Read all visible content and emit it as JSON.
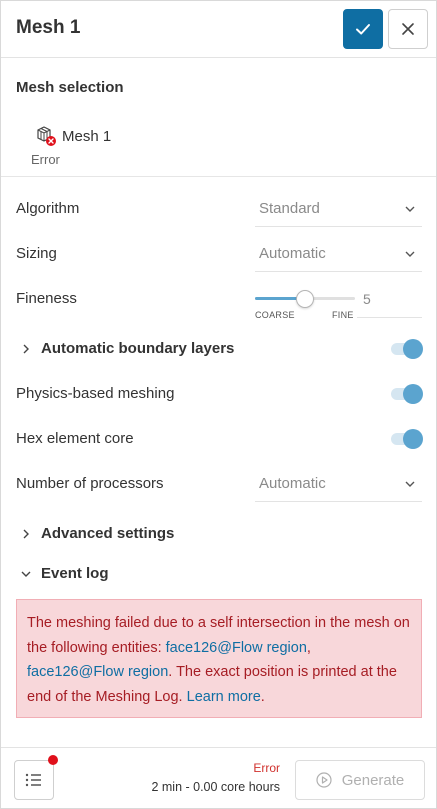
{
  "header": {
    "title": "Mesh 1"
  },
  "mesh_selection": {
    "title": "Mesh selection",
    "item_name": "Mesh 1",
    "item_status": "Error"
  },
  "settings": {
    "algorithm": {
      "label": "Algorithm",
      "value": "Standard"
    },
    "sizing": {
      "label": "Sizing",
      "value": "Automatic"
    },
    "fineness": {
      "label": "Fineness",
      "value": "5",
      "min_label": "COARSE",
      "max_label": "FINE",
      "level_fraction": 0.5
    },
    "auto_boundary_layers": {
      "label": "Automatic boundary layers",
      "enabled": true
    },
    "physics_based_meshing": {
      "label": "Physics-based meshing",
      "enabled": true
    },
    "hex_element_core": {
      "label": "Hex element core",
      "enabled": true
    },
    "processors": {
      "label": "Number of processors",
      "value": "Automatic"
    },
    "advanced": {
      "label": "Advanced settings"
    },
    "event_log": {
      "label": "Event log"
    }
  },
  "error_message": {
    "text_1": "The meshing failed due to a self intersection in the mesh on the following entities: ",
    "entity_1": "face126@Flow region",
    "separator": ", ",
    "entity_2": "face126@Flow region",
    "text_2": ". The exact position is printed at the end of the Meshing Log. ",
    "learn_more": "Learn more",
    "text_3": "."
  },
  "footer": {
    "status": "Error",
    "time": "2 min - 0.00 core hours",
    "generate_label": "Generate"
  },
  "colors": {
    "primary": "#0f6ea3",
    "toggle": "#5ba4cf",
    "error_bg": "#f8d7da",
    "error_text": "#a61d24",
    "notification": "#e0101b"
  },
  "icons": {
    "confirm": "check-icon",
    "close": "close-icon",
    "mesh": "mesh-cube-icon",
    "error_badge": "error-badge-icon",
    "dropdown": "chevron-down-icon",
    "expand": "chevron-right-icon",
    "collapse": "chevron-down-icon",
    "log": "list-icon",
    "generate": "play-icon"
  }
}
